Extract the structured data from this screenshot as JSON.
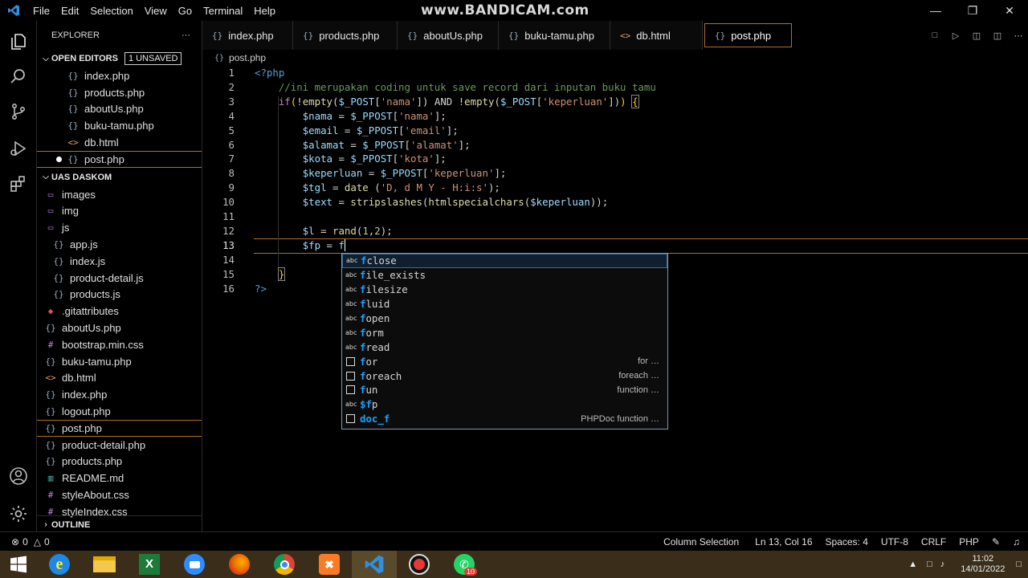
{
  "menu": [
    "File",
    "Edit",
    "Selection",
    "View",
    "Go",
    "Terminal",
    "Help"
  ],
  "watermark": "www.BANDICAM.com",
  "explorer": {
    "title": "EXPLORER",
    "more": "···",
    "open_editors_label": "OPEN EDITORS",
    "unsaved_badge": "1 UNSAVED",
    "open_editors": [
      {
        "icon": "{}",
        "name": "index.php"
      },
      {
        "icon": "{}",
        "name": "products.php"
      },
      {
        "icon": "{}",
        "name": "aboutUs.php"
      },
      {
        "icon": "{}",
        "name": "buku-tamu.php"
      },
      {
        "icon": "<>",
        "name": "db.html"
      },
      {
        "icon": "{}",
        "name": "post.php"
      }
    ],
    "project_label": "UAS DASKOM",
    "files": [
      {
        "icon": "▭",
        "name": "images",
        "indent": 0
      },
      {
        "icon": "▭",
        "name": "img",
        "indent": 0
      },
      {
        "icon": "▭",
        "name": "js",
        "indent": 0
      },
      {
        "icon": "{}",
        "name": "app.js",
        "indent": 1
      },
      {
        "icon": "{}",
        "name": "index.js",
        "indent": 1
      },
      {
        "icon": "{}",
        "name": "product-detail.js",
        "indent": 1
      },
      {
        "icon": "{}",
        "name": "products.js",
        "indent": 1
      },
      {
        "icon": "◆",
        "name": ".gitattributes",
        "indent": 0
      },
      {
        "icon": "{}",
        "name": "aboutUs.php",
        "indent": 0
      },
      {
        "icon": "#",
        "name": "bootstrap.min.css",
        "indent": 0
      },
      {
        "icon": "{}",
        "name": "buku-tamu.php",
        "indent": 0
      },
      {
        "icon": "<>",
        "name": "db.html",
        "indent": 0
      },
      {
        "icon": "{}",
        "name": "index.php",
        "indent": 0
      },
      {
        "icon": "{}",
        "name": "logout.php",
        "indent": 0
      },
      {
        "icon": "{}",
        "name": "post.php",
        "indent": 0
      },
      {
        "icon": "{}",
        "name": "product-detail.php",
        "indent": 0
      },
      {
        "icon": "{}",
        "name": "products.php",
        "indent": 0
      },
      {
        "icon": "▥",
        "name": "README.md",
        "indent": 0
      },
      {
        "icon": "#",
        "name": "styleAbout.css",
        "indent": 0
      },
      {
        "icon": "#",
        "name": "styleIndex.css",
        "indent": 0
      }
    ],
    "outline_label": "OUTLINE"
  },
  "tabs": [
    {
      "icon": "{}",
      "name": "index.php"
    },
    {
      "icon": "{}",
      "name": "products.php"
    },
    {
      "icon": "{}",
      "name": "aboutUs.php"
    },
    {
      "icon": "{}",
      "name": "buku-tamu.php"
    },
    {
      "icon": "<>",
      "name": "db.html"
    },
    {
      "icon": "{}",
      "name": "post.php"
    }
  ],
  "breadcrumb": {
    "icon": "{}",
    "file": "post.php"
  },
  "editor": {
    "line_numbers": [
      "1",
      "2",
      "3",
      "4",
      "5",
      "6",
      "7",
      "8",
      "9",
      "10",
      "11",
      "12",
      "13",
      "14",
      "15",
      "16"
    ]
  },
  "suggestions": [
    {
      "icon": "abc",
      "match": "f",
      "rest": "close",
      "detail": ""
    },
    {
      "icon": "abc",
      "match": "f",
      "rest": "ile_exists",
      "detail": ""
    },
    {
      "icon": "abc",
      "match": "f",
      "rest": "ilesize",
      "detail": ""
    },
    {
      "icon": "abc",
      "match": "f",
      "rest": "luid",
      "detail": ""
    },
    {
      "icon": "abc",
      "match": "f",
      "rest": "open",
      "detail": ""
    },
    {
      "icon": "abc",
      "match": "f",
      "rest": "orm",
      "detail": ""
    },
    {
      "icon": "abc",
      "match": "f",
      "rest": "read",
      "detail": ""
    },
    {
      "icon": "box",
      "match": "f",
      "rest": "or",
      "detail": "for …"
    },
    {
      "icon": "box",
      "match": "f",
      "rest": "oreach",
      "detail": "foreach …"
    },
    {
      "icon": "box",
      "match": "f",
      "rest": "un",
      "detail": "function …"
    },
    {
      "icon": "abc",
      "match": "$f",
      "rest": "p",
      "detail": ""
    },
    {
      "icon": "box",
      "match": "doc_f",
      "rest": "",
      "detail": "PHPDoc function …"
    }
  ],
  "status": {
    "errors": "0",
    "warnings": "0",
    "mode": "Column Selection",
    "position": "Ln 13, Col 16",
    "spaces": "Spaces: 4",
    "encoding": "UTF-8",
    "eol": "CRLF",
    "language": "PHP"
  },
  "taskbar": {
    "time": "11:02",
    "date": "14/01/2022",
    "whatsapp_badge": "10"
  },
  "colors": {
    "accent_border": "#b06f2a",
    "suggest_highlight": "#18a3ff",
    "taskbar": "#3a2e1a"
  }
}
